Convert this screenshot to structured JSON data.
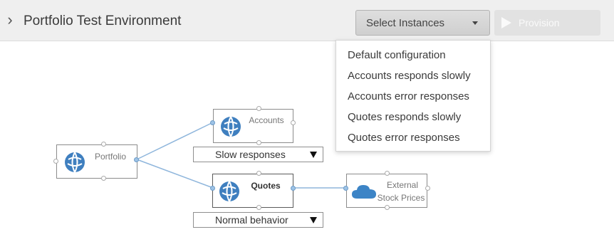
{
  "header": {
    "title": "Portfolio Test Environment",
    "select_label": "Select Instances",
    "provision_label": "Provision"
  },
  "menu": {
    "items": [
      "Default configuration",
      "Accounts responds slowly",
      "Accounts error responses",
      "Quotes responds slowly",
      "Quotes error responses"
    ]
  },
  "diagram": {
    "nodes": {
      "portfolio": {
        "label": "Portfolio",
        "icon": "globe-icon"
      },
      "accounts": {
        "label": "Accounts",
        "icon": "globe-icon"
      },
      "quotes": {
        "label": "Quotes",
        "icon": "globe-icon"
      },
      "external": {
        "label_line1": "External",
        "label_line2": "Stock Prices",
        "icon": "cloud-icon"
      }
    },
    "accounts_behavior": "Slow responses",
    "quotes_behavior": "Normal behavior"
  },
  "colors": {
    "globe": "#3f7fbf",
    "connector": "#8fb6dc",
    "cloud": "#3c84c6"
  }
}
